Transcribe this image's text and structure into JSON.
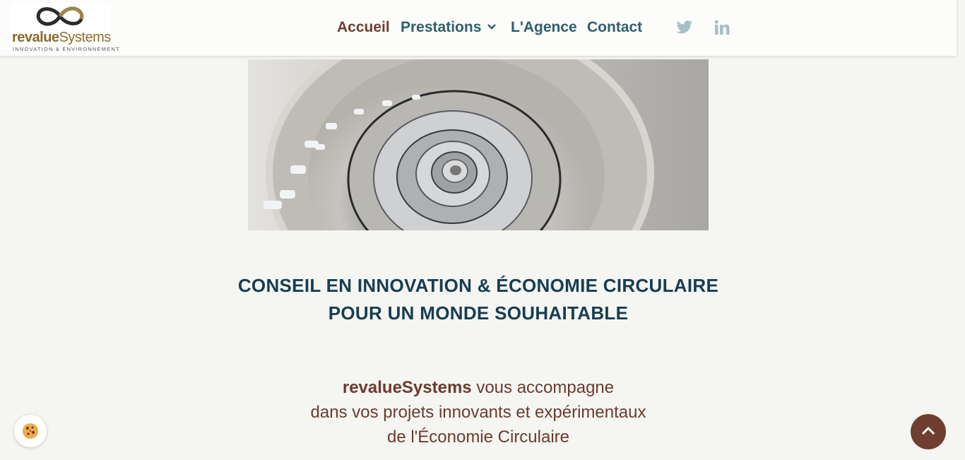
{
  "header": {
    "logo": {
      "brand_bold": "revalue",
      "brand_rest": "Systems",
      "tagline": "INNOVATION & ENVIRONNEMENT"
    },
    "nav": [
      {
        "label": "Accueil",
        "active": true
      },
      {
        "label": "Prestations",
        "has_dropdown": true
      },
      {
        "label": "L'Agence"
      },
      {
        "label": "Contact"
      }
    ],
    "social": [
      "twitter-icon",
      "linkedin-icon"
    ]
  },
  "hero": {
    "image": "spiral-staircase"
  },
  "headline": {
    "line1": "CONSEIL EN INNOVATION & ÉCONOMIE CIRCULAIRE",
    "line2": "POUR UN MONDE SOUHAITABLE"
  },
  "intro": {
    "brand": "revalueSystems",
    "line1_rest": " vous accompagne",
    "line2": "dans vos projets innovants et expérimentaux",
    "line3": "de l'Économie Circulaire"
  },
  "widgets": {
    "cookie": "cookie-icon",
    "back_to_top": "chevron-up-icon"
  },
  "colors": {
    "page_bg": "#f5f5f2",
    "nav_active": "#6e3f30",
    "nav": "#2f5f6a",
    "headline": "#163d52",
    "intro_text": "#6b3b2e",
    "social_icons": "#a9bfc5",
    "back_to_top_bg": "#6e3f30"
  }
}
